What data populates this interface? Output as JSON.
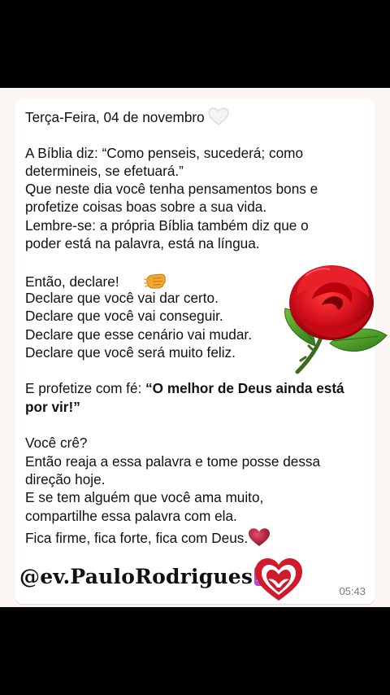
{
  "message": {
    "date_line": "Terça-Feira, 04 de novembro",
    "p1": [
      "A Bíblia diz: “Como penseis, sucederá; como",
      "determineis, se efetuará.”",
      "Que neste dia você tenha pensamentos bons e",
      "profetize coisas boas sobre a sua vida.",
      "Lembre-se: a própria Bíblia também diz que o",
      "poder está na palavra, está na língua."
    ],
    "declare_intro": "Então, declare!",
    "declarations": [
      "Declare que você vai dar certo.",
      "Declare que você vai conseguir.",
      "Declare que esse cenário vai mudar.",
      "Declare que você será muito feliz."
    ],
    "prophesy_prefix": "E profetize com fé: ",
    "prophesy_bold_1": "“O melhor de Deus ainda está",
    "prophesy_bold_2": "por vir!”",
    "p3": [
      "Você crê?",
      "Então reaja a essa palavra e tome posse dessa",
      "direção hoje.",
      "E se tem alguém que você ama muito,",
      "compartilhe essa palavra com ela.",
      "Fica firme, fica forte, fica com Deus."
    ],
    "time": "05:43"
  },
  "watermark": {
    "handle": "@ev.PauloRodrigues"
  },
  "icons": {
    "date_emoji": "white-heart-icon",
    "declare_emoji": "fist-bump-icon",
    "closing_emoji": "red-heart-icon",
    "handle_emoji": "star-of-david-icon",
    "decor_image": "red-rose",
    "logo": "heart-dove-logo"
  },
  "colors": {
    "bubble": "#ffffff",
    "background": "#fbf5f3",
    "rose": "#d4101c",
    "logo_heart": "#d11a2a"
  }
}
